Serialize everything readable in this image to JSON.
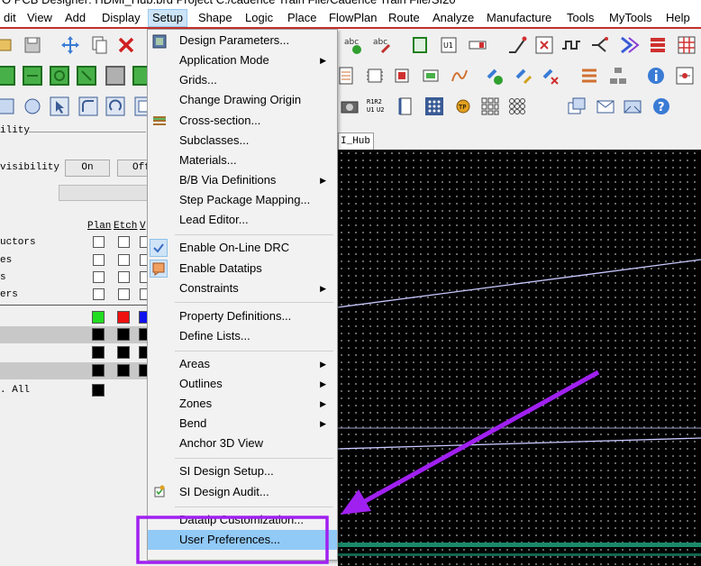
{
  "window": {
    "title": "O PCB Designer: HDMI_Hub.brd  Project C:/cadence Train File/Cadence Train File/SI20"
  },
  "menubar": {
    "items": [
      {
        "label": "dit",
        "name": "menu-edit"
      },
      {
        "label": "View",
        "name": "menu-view"
      },
      {
        "label": "Add",
        "name": "menu-add"
      },
      {
        "label": "Display",
        "name": "menu-display"
      },
      {
        "label": "Setup",
        "name": "menu-setup"
      },
      {
        "label": "Shape",
        "name": "menu-shape"
      },
      {
        "label": "Logic",
        "name": "menu-logic"
      },
      {
        "label": "Place",
        "name": "menu-place"
      },
      {
        "label": "FlowPlan",
        "name": "menu-flowplan"
      },
      {
        "label": "Route",
        "name": "menu-route"
      },
      {
        "label": "Analyze",
        "name": "menu-analyze"
      },
      {
        "label": "Manufacture",
        "name": "menu-manufacture"
      },
      {
        "label": "Tools",
        "name": "menu-tools"
      },
      {
        "label": "MyTools",
        "name": "menu-mytools"
      },
      {
        "label": "Help",
        "name": "menu-help"
      }
    ]
  },
  "left_panel": {
    "visibility_title": "ility",
    "visibility_label": "visibility",
    "on_button": "On",
    "off_button": "Off",
    "columns": [
      "Plan",
      "Etch",
      "V"
    ],
    "rows": [
      "uctors",
      "es",
      "s",
      "ers"
    ],
    "all_label": ". All"
  },
  "canvas": {
    "tab_label": "I_Hub"
  },
  "setup_menu": {
    "items": [
      {
        "label": "Design Parameters...",
        "submenu": false
      },
      {
        "label": "Application Mode",
        "submenu": true
      },
      {
        "label": "Grids...",
        "submenu": false
      },
      {
        "label": "Change Drawing Origin",
        "submenu": false
      },
      {
        "label": "Cross-section...",
        "submenu": false
      },
      {
        "label": "Subclasses...",
        "submenu": false
      },
      {
        "label": "Materials...",
        "submenu": false
      },
      {
        "label": "B/B Via Definitions",
        "submenu": true
      },
      {
        "label": "Step Package Mapping...",
        "submenu": false
      },
      {
        "label": "Lead Editor...",
        "submenu": false
      },
      {
        "label": "Enable On-Line DRC",
        "submenu": false
      },
      {
        "label": "Enable Datatips",
        "submenu": false
      },
      {
        "label": "Constraints",
        "submenu": true
      },
      {
        "label": "Property Definitions...",
        "submenu": false
      },
      {
        "label": "Define Lists...",
        "submenu": false
      },
      {
        "label": "Areas",
        "submenu": true
      },
      {
        "label": "Outlines",
        "submenu": true
      },
      {
        "label": "Zones",
        "submenu": true
      },
      {
        "label": "Bend",
        "submenu": true
      },
      {
        "label": "Anchor 3D View",
        "submenu": false
      },
      {
        "label": "SI Design Setup...",
        "submenu": false
      },
      {
        "label": "SI Design Audit...",
        "submenu": false
      },
      {
        "label": "Datatip Customization...",
        "submenu": false
      },
      {
        "label": "User Preferences...",
        "submenu": false
      }
    ],
    "highlighted": "User Preferences..."
  },
  "colors": {
    "menu_highlight": "#91c9f7",
    "annotation": "#a020f0",
    "canvas_bg": "#000000",
    "trace": "#c8c8ff",
    "bottom_bar": "#1a8a6a"
  }
}
